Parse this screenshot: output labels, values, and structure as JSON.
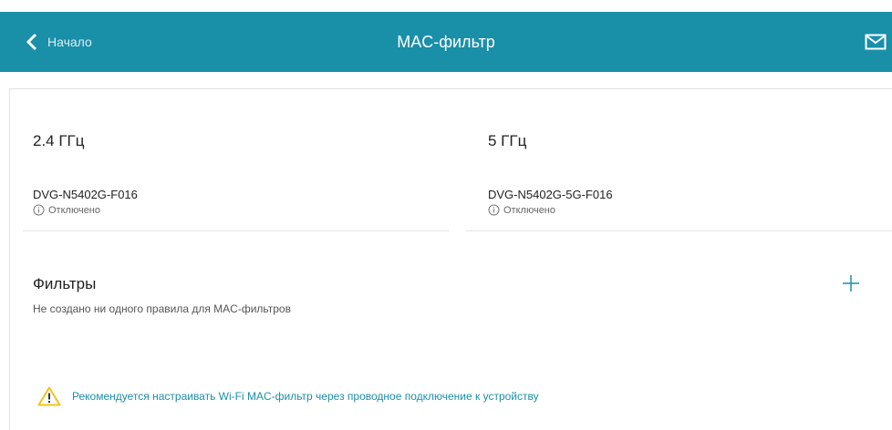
{
  "header": {
    "back_label": "Начало",
    "title": "MAC-фильтр",
    "background": "#1a8fa8",
    "back_icon": "chevron-left-icon",
    "mail_icon": "mail-icon"
  },
  "bands": [
    {
      "name": "2.4 ГГц",
      "ssid": "DVG-N5402G-F016",
      "status": "Отключено"
    },
    {
      "name": "5 ГГц",
      "ssid": "DVG-N5402G-5G-F016",
      "status": "Отключено"
    }
  ],
  "filters": {
    "title": "Фильтры",
    "empty_message": "Не создано ни одного правила для MAC-фильтров",
    "add_icon": "plus-icon"
  },
  "warning": {
    "text": "Рекомендуется настраивать Wi-Fi MAC-фильтр через проводное подключение к устройству",
    "icon": "warning-icon",
    "icon_color": "#f0c419"
  }
}
